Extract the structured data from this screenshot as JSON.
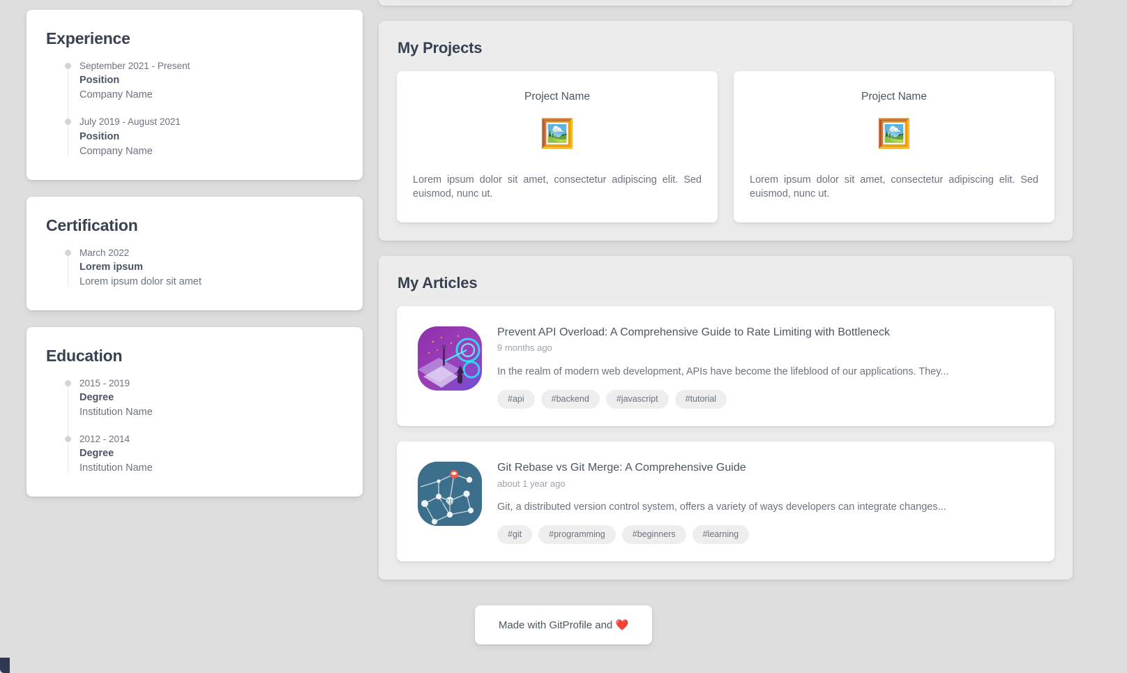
{
  "theme": {
    "page_bg": "#dedede",
    "card_bg": "#ffffff",
    "panel_bg": "#ececec",
    "heading_color": "#374151",
    "body_color": "#6b7280",
    "tag_bg": "#eeeeee",
    "timeline_dot": "#d1d5db"
  },
  "sidebar": {
    "experience": {
      "title": "Experience",
      "items": [
        {
          "date": "September 2021 - Present",
          "position": "Position",
          "company": "Company Name"
        },
        {
          "date": "July 2019 - August 2021",
          "position": "Position",
          "company": "Company Name"
        }
      ]
    },
    "certification": {
      "title": "Certification",
      "items": [
        {
          "date": "March 2022",
          "name": "Lorem ipsum",
          "body": "Lorem ipsum dolor sit amet"
        }
      ]
    },
    "education": {
      "title": "Education",
      "items": [
        {
          "date": "2015 - 2019",
          "degree": "Degree",
          "institution": "Institution Name"
        },
        {
          "date": "2012 - 2014",
          "degree": "Degree",
          "institution": "Institution Name"
        }
      ]
    }
  },
  "projects": {
    "title": "My Projects",
    "items": [
      {
        "name": "Project Name",
        "thumb_icon": "framed-picture-emoji",
        "thumb_glyph": "🖼️",
        "description": "Lorem ipsum dolor sit amet, consectetur adipiscing elit. Sed euismod, nunc ut."
      },
      {
        "name": "Project Name",
        "thumb_icon": "framed-picture-emoji",
        "thumb_glyph": "🖼️",
        "description": "Lorem ipsum dolor sit amet, consectetur adipiscing elit. Sed euismod, nunc ut."
      }
    ]
  },
  "articles": {
    "title": "My Articles",
    "items": [
      {
        "title": "Prevent API Overload: A Comprehensive Guide to Rate Limiting with Bottleneck",
        "time": "9 months ago",
        "description": "In the realm of modern web development, APIs have become the lifeblood of our applications. They...",
        "thumb_icon": "purple-isometric-tech-thumbnail",
        "tags": [
          "#api",
          "#backend",
          "#javascript",
          "#tutorial"
        ]
      },
      {
        "title": "Git Rebase vs Git Merge: A Comprehensive Guide",
        "time": "about 1 year ago",
        "description": "Git, a distributed version control system, offers a variety of ways developers can integrate changes...",
        "thumb_icon": "teal-network-graph-thumbnail",
        "tags": [
          "#git",
          "#programming",
          "#beginners",
          "#learning"
        ]
      }
    ]
  },
  "footer": {
    "text": "Made with GitProfile and ❤️"
  }
}
